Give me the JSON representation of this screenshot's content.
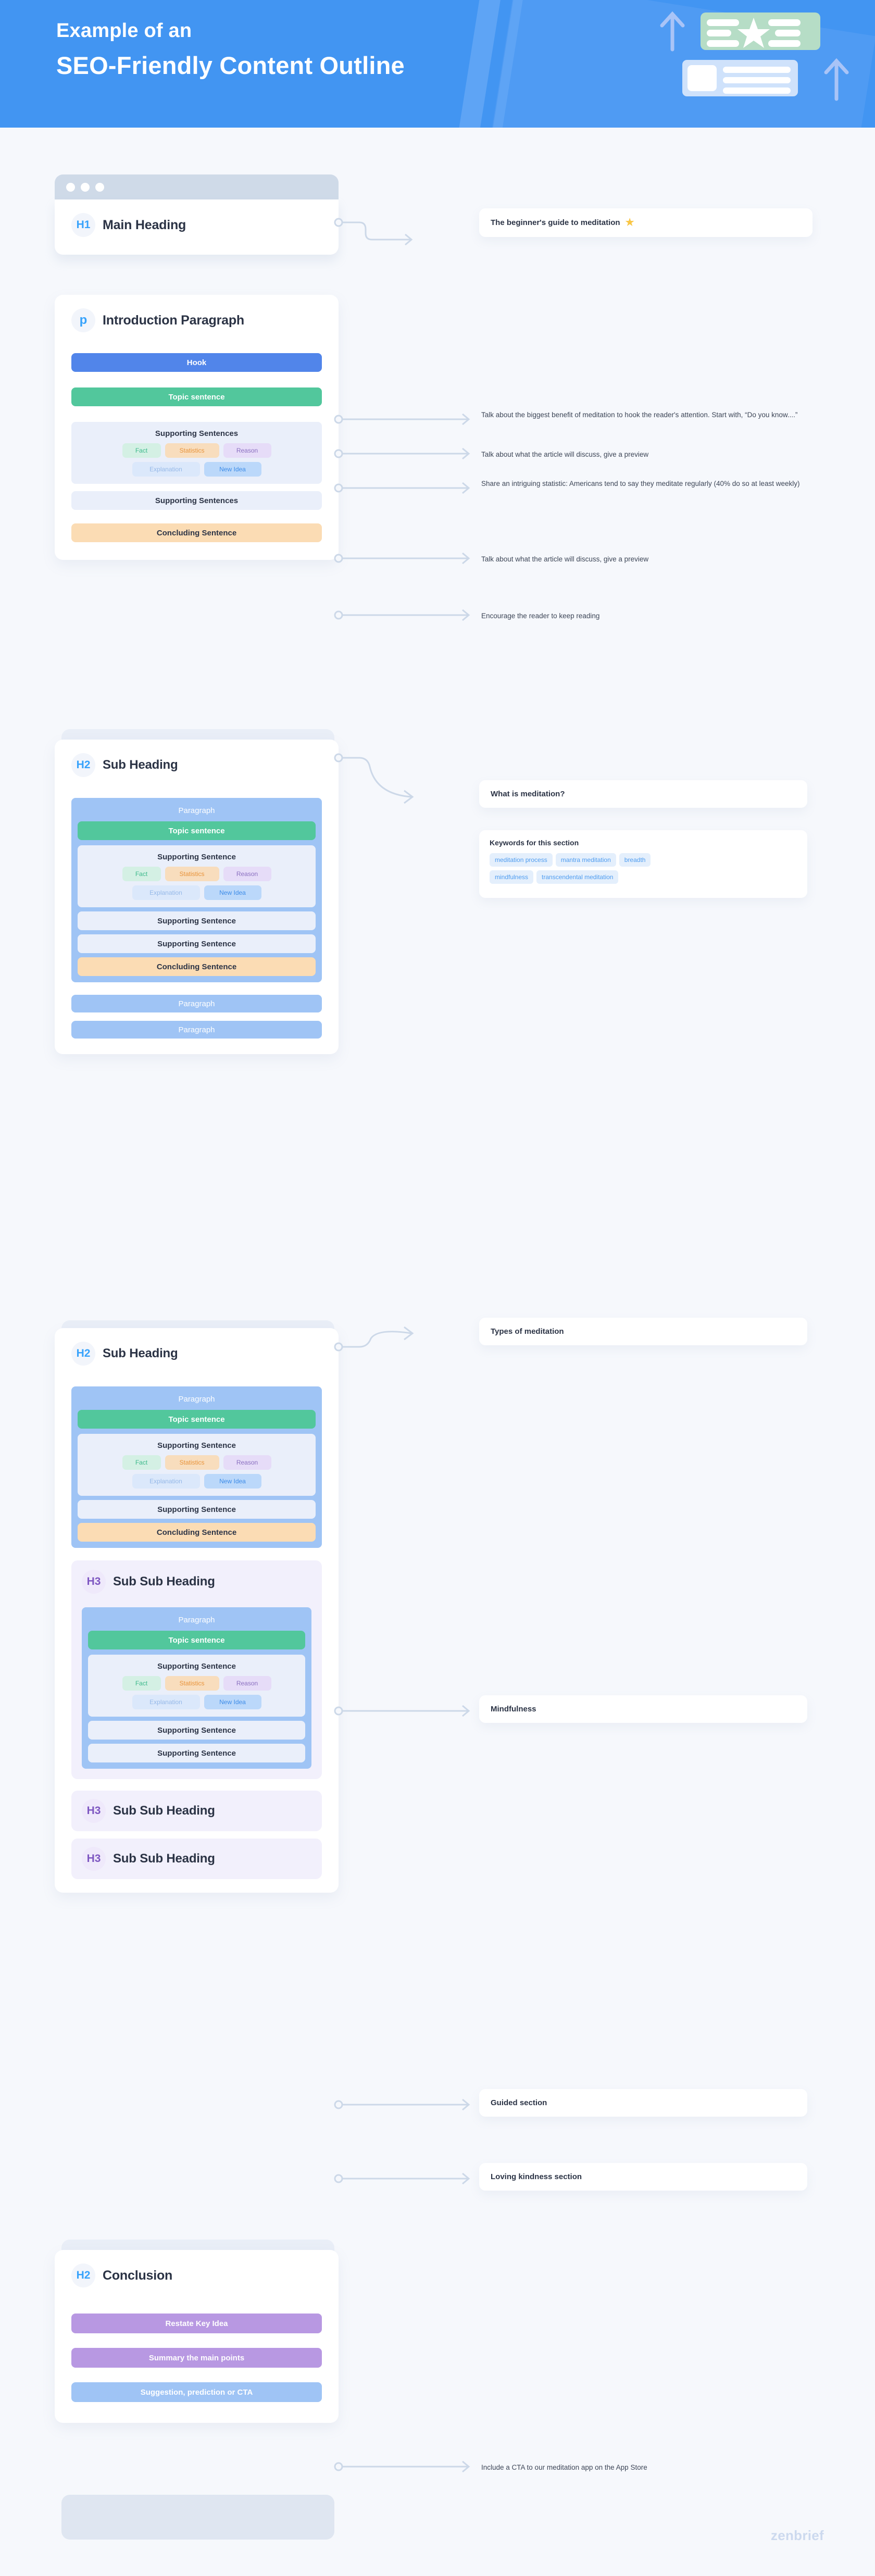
{
  "header": {
    "line1": "Example of an",
    "line2": "SEO-Friendly Content Outline",
    "bg_color": "#4295f2"
  },
  "brand": {
    "name": "zenbrief"
  },
  "labels": {
    "hook": "Hook",
    "topic_sentence": "Topic sentence",
    "supporting_sentences": "Supporting Sentences",
    "supporting_sentence": "Supporting Sentence",
    "concluding_sentence": "Concluding Sentence",
    "paragraph": "Paragraph",
    "tag_fact": "Fact",
    "tag_statistics": "Statistics",
    "tag_reason": "Reason",
    "tag_explanation": "Explanation",
    "tag_new_idea": "New Idea",
    "keywords_title": "Keywords for this section"
  },
  "sections": {
    "h1": {
      "badge": "H1",
      "title": "Main Heading",
      "callout": "The beginner's guide to meditation",
      "callout_icon": "star-icon"
    },
    "intro": {
      "badge": "p",
      "title": "Introduction Paragraph",
      "notes": {
        "hook": "Talk about the biggest benefit of meditation to hook the reader's attention. Start with, “Do you know....”",
        "topic": "Talk about what the article will discuss, give a preview",
        "support1": "Share an intriguing statistic: Americans tend to say they meditate regularly (40% do so at least weekly)",
        "support2": "Talk about what the article will discuss, give a preview",
        "conclude": "Encourage the reader to keep reading"
      }
    },
    "h2_first": {
      "badge": "H2",
      "title": "Sub Heading",
      "callout": "What is meditation?",
      "keywords": [
        "meditation process",
        "mantra meditation",
        "breadth",
        "mindfulness",
        "transcendental meditation"
      ]
    },
    "h2_second": {
      "badge": "H2",
      "title": "Sub Heading",
      "callout": "Types of meditation"
    },
    "h3_first": {
      "badge": "H3",
      "title": "Sub Sub Heading",
      "callout": "Mindfulness"
    },
    "h3_second": {
      "badge": "H3",
      "title": "Sub Sub Heading",
      "callout": "Guided  section"
    },
    "h3_third": {
      "badge": "H3",
      "title": "Sub Sub Heading",
      "callout": "Loving kindness section"
    },
    "conclusion": {
      "badge": "H2",
      "title": "Conclusion",
      "restate": "Restate Key Idea",
      "summary": "Summary the main points",
      "cta": "Suggestion, prediction or CTA",
      "cta_note": "Include a CTA to our meditation app on the App Store"
    }
  },
  "colors": {
    "header_blue": "#4295f2",
    "hook_blue": "#5185ea",
    "topic_green": "#52c79c",
    "support_grey": "#eaeffa",
    "conclude_orange": "#fbdcb4",
    "paragraph_blue": "#9fc4f5",
    "purple": "#b898e2",
    "h3_badge_purple": "#7e57c2",
    "h_badge_blue": "#36a2fb",
    "star_yellow": "#f9c645"
  }
}
